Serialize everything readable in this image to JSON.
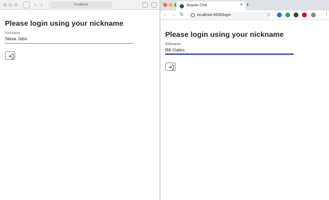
{
  "safari": {
    "address": "localhost",
    "heading": "Please login using your nickname",
    "nickname_label": "Nickname",
    "nickname_value": "Steve Jobs"
  },
  "chrome": {
    "tab_title": "Angular Chat",
    "tab_close": "×",
    "new_tab": "+",
    "url": "localhost:4200/login",
    "heading": "Please login using your nickname",
    "nickname_label": "Nickname",
    "nickname_value": "Bill Gates",
    "extensions": [
      {
        "name": "extension-blue-icon",
        "color": "#1a73e8"
      },
      {
        "name": "extension-green-icon",
        "color": "#34a853"
      },
      {
        "name": "extension-dark-icon",
        "color": "#3c4043"
      },
      {
        "name": "extension-pinterest-icon",
        "color": "#e60023"
      },
      {
        "name": "extension-gray-icon",
        "color": "#8a8a8a"
      }
    ]
  },
  "colors": {
    "focus_accent": "#3f51b5",
    "input_underline": "#9e9e9e"
  }
}
